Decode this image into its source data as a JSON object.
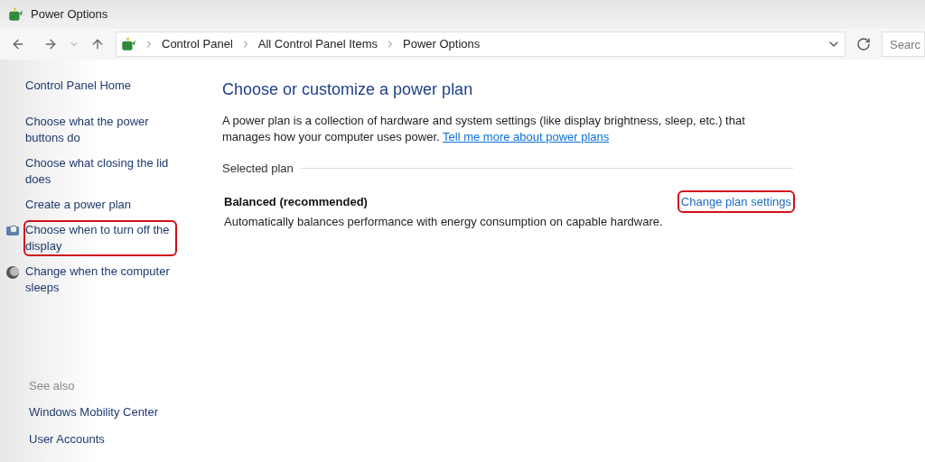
{
  "window": {
    "title": "Power Options"
  },
  "address_bar": {
    "breadcrumbs": [
      "Control Panel",
      "All Control Panel Items",
      "Power Options"
    ],
    "search_placeholder": "Searc"
  },
  "sidebar": {
    "items": [
      {
        "label": "Control Panel Home",
        "kind": "home",
        "highlighted": false
      },
      {
        "label": "Choose what the power buttons do",
        "kind": "plain",
        "highlighted": false
      },
      {
        "label": "Choose what closing the lid does",
        "kind": "plain",
        "highlighted": false
      },
      {
        "label": "Create a power plan",
        "kind": "plain",
        "highlighted": false
      },
      {
        "label": "Choose when to turn off the display",
        "kind": "display",
        "highlighted": true
      },
      {
        "label": "Change when the computer sleeps",
        "kind": "sleep",
        "highlighted": false
      }
    ],
    "see_also": {
      "heading": "See also",
      "items": [
        "Windows Mobility Center",
        "User Accounts"
      ]
    }
  },
  "main": {
    "title": "Choose or customize a power plan",
    "description": "A power plan is a collection of hardware and system settings (like display brightness, sleep, etc.) that manages how your computer uses power.",
    "link": "Tell me more about power plans",
    "section": "Selected plan",
    "plan": {
      "name": "Balanced (recommended)",
      "description": "Automatically balances performance with energy consumption on capable hardware.",
      "action": "Change plan settings",
      "highlighted": true
    }
  }
}
